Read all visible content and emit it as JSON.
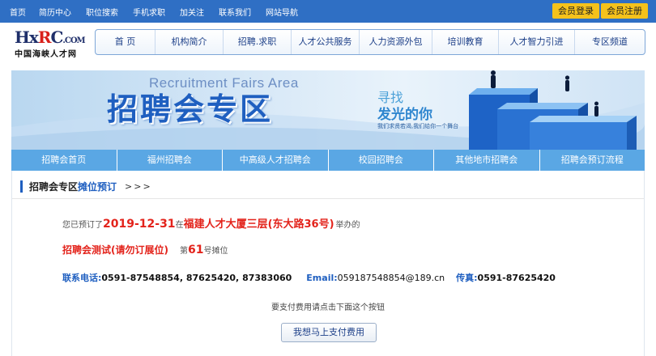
{
  "topbar": {
    "links": [
      "首页",
      "简历中心",
      "职位搜索",
      "手机求职",
      "加关注",
      "联系我们",
      "网站导航"
    ],
    "login_label": "会员登录",
    "register_label": "会员注册"
  },
  "logo": {
    "mark_h": "H",
    "mark_x": "x",
    "mark_r": "R",
    "mark_c": "C",
    "mark_com": ".COM",
    "name": "中国海峡人才网"
  },
  "main_nav": [
    "首 页",
    "机构简介",
    "招聘.求职",
    "人才公共服务",
    "人力资源外包",
    "培训教育",
    "人才智力引进",
    "专区频道"
  ],
  "banner": {
    "english": "Recruitment Fairs Area",
    "chinese": "招聘会专区",
    "slogan1": "寻找",
    "slogan2": "发光的你",
    "slogan3": "我们求贤若渴,我们给你一个舞台"
  },
  "sub_nav": [
    "招聘会首页",
    "福州招聘会",
    "中高级人才招聘会",
    "校园招聘会",
    "其他地市招聘会",
    "招聘会预订流程"
  ],
  "breadcrumb": {
    "part1": "招聘会专区",
    "part2": "摊位预订",
    "arrows": ">>>"
  },
  "booking": {
    "prefix": "您已预订了",
    "date": "2019-12-31",
    "at": "在",
    "location": "福建人才大厦三层(东大路36号)",
    "suffix": "举办的",
    "fair_title": "招聘会测试(请勿订展位)",
    "booth_prefix": "第",
    "booth_number": "61",
    "booth_suffix": "号摊位"
  },
  "contact": {
    "phone_label": "联系电话:",
    "phone": "0591-87548854, 87625420, 87383060",
    "email_label": "Email:",
    "email": "059187548854@189.cn",
    "fax_label": "传真:",
    "fax": "0591-87625420"
  },
  "payment": {
    "tip": "要支付费用请点击下面这个按钮",
    "button": "我想马上支付费用"
  },
  "colors": {
    "topbar": "#2f6fc4",
    "accent_red": "#e3231b",
    "accent_blue": "#1f5fc0",
    "subnav": "#5aa7e4",
    "button_yellow": "#f5c21b"
  }
}
